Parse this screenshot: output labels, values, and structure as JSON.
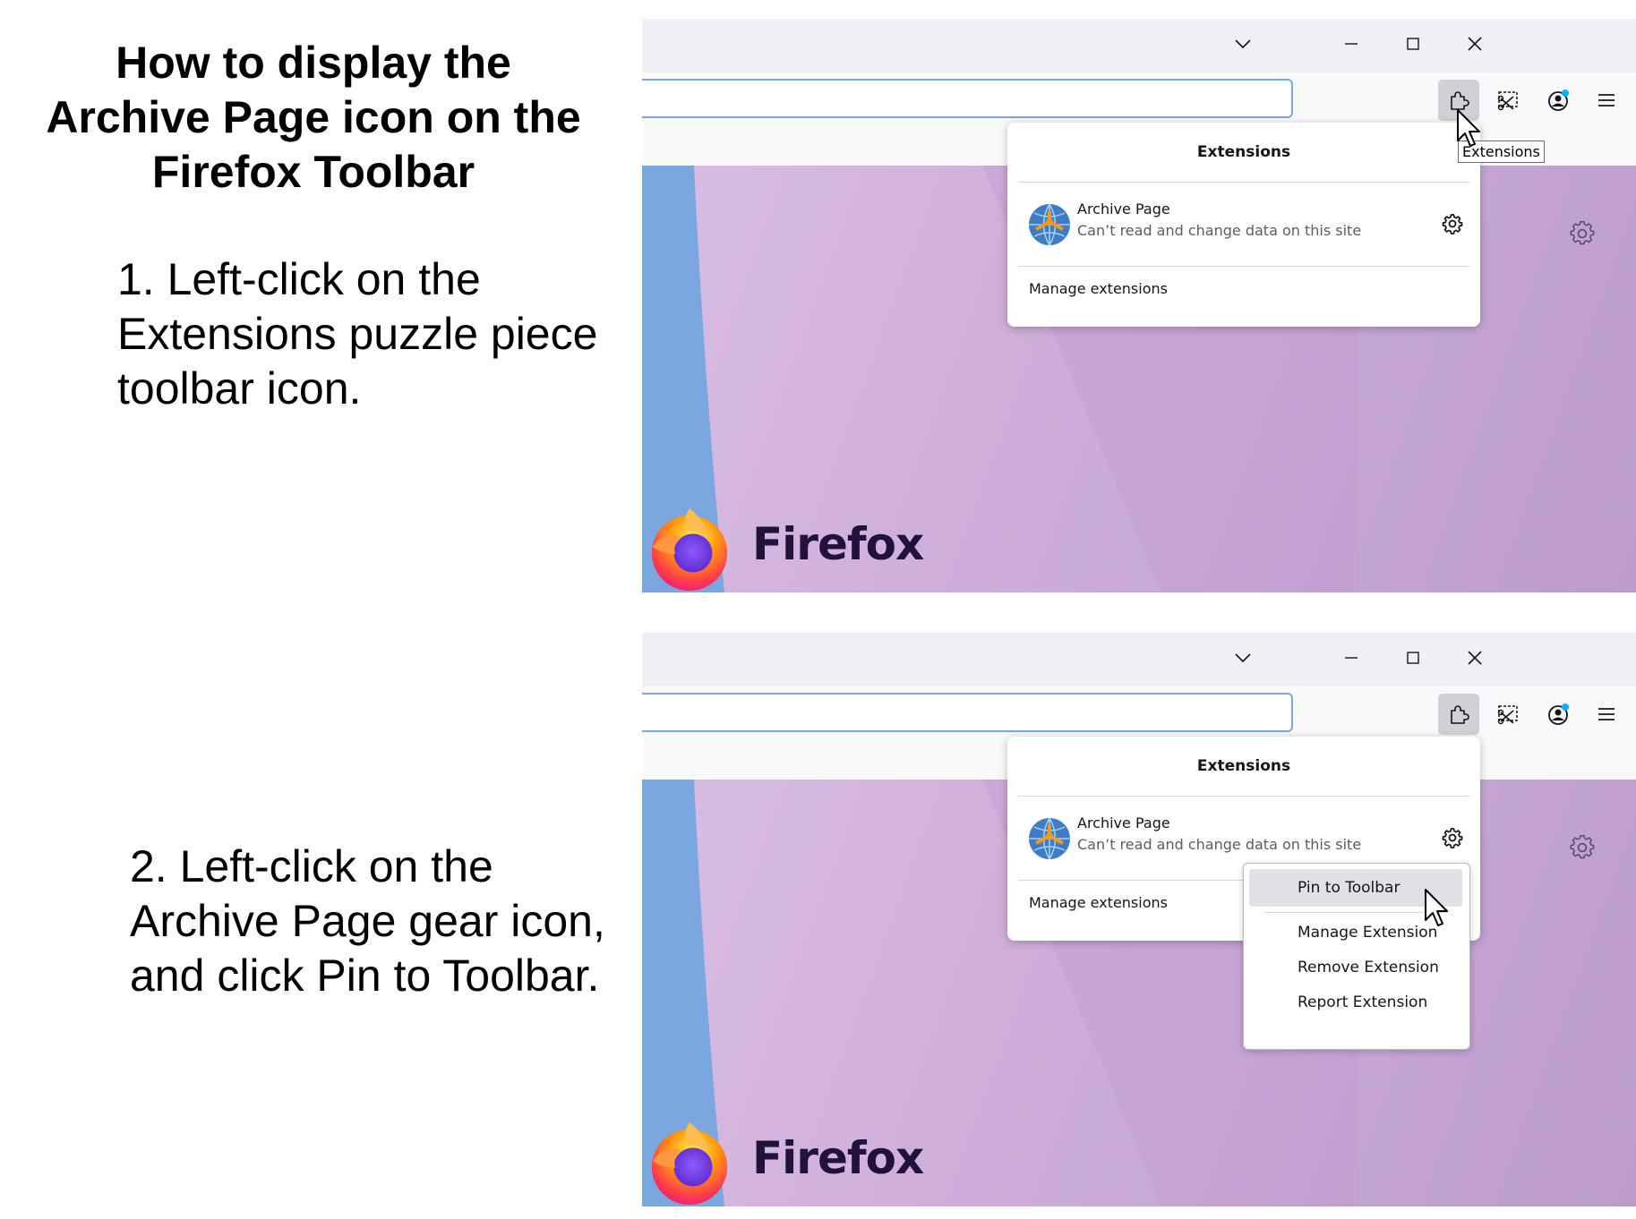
{
  "heading": "How to display the Archive Page icon on the Firefox Toolbar",
  "step1": "1. Left-click on the Extensions puzzle piece toolbar icon.",
  "step2": "2. Left-click on the Archive Page gear icon, and click Pin to Toolbar.",
  "screenshot1": {
    "tooltip": "Extensions",
    "panel_title": "Extensions",
    "extension_name": "Archive Page",
    "extension_status": "Can’t read and change data on this site",
    "manage_link": "Manage extensions",
    "brand_name": "Firefox"
  },
  "screenshot2": {
    "panel_title": "Extensions",
    "extension_name": "Archive Page",
    "extension_status": "Can’t read and change data on this site",
    "manage_link": "Manage extensions",
    "brand_name": "Firefox",
    "context_menu": {
      "pin": "Pin to Toolbar",
      "manage": "Manage Extension",
      "remove": "Remove Extension",
      "report": "Report Extension"
    }
  },
  "icons": [
    "chevron-down-icon",
    "minimize-icon",
    "maximize-icon",
    "close-icon",
    "puzzle-icon",
    "screenshot-icon",
    "account-icon",
    "menu-icon",
    "gear-icon",
    "globe-icon",
    "firefox-logo",
    "cursor-icon"
  ],
  "colors": {
    "url_focus": "#7da7e0",
    "titlebar": "#f0f0f4",
    "background": "#d3b5df",
    "brand_text": "#20123a"
  }
}
